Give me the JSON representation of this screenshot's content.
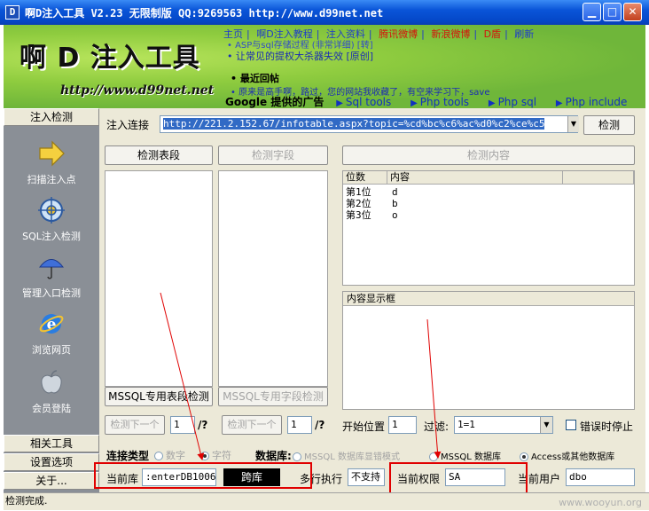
{
  "window": {
    "app_icon": "D",
    "title": "啊D注入工具 V2.23 无限制版 QQ:9269563 http://www.d99net.net"
  },
  "banner": {
    "logo": "啊 D 注入工具",
    "logo_url": "http://www.d99net.net",
    "menu": [
      {
        "label": "主页",
        "color": "#1d3bcc"
      },
      {
        "label": "啊D注入教程",
        "color": "#1d3bcc"
      },
      {
        "label": "注入资料",
        "color": "#1d3bcc"
      },
      {
        "label": "腾讯微博",
        "color": "#d4140c"
      },
      {
        "label": "新浪微博",
        "color": "#d4140c"
      },
      {
        "label": "D盾",
        "color": "#d4140c"
      },
      {
        "label": "刷新",
        "color": "#1d3bcc"
      }
    ],
    "line1": "• ASP与sql存储过程 (非常详细) [转]",
    "line2": "• 让常见的提权大杀器失效 [原创]",
    "hot_title": "最近回帖",
    "hot_line": "• 原来是高手啊，路过，您的网站我收藏了，有空来学习下，save",
    "ads_title": "Google 提供的广告",
    "ads": [
      "Sql tools",
      "Php tools",
      "Php sql",
      "Php include"
    ]
  },
  "sidebar": {
    "top_tab": "注入检测",
    "items": [
      {
        "label": "扫描注入点",
        "icon": "arrow-right-icon"
      },
      {
        "label": "SQL注入检测",
        "icon": "target-icon"
      },
      {
        "label": "管理入口检测",
        "icon": "umbrella-icon"
      },
      {
        "label": "浏览网页",
        "icon": "ie-browser-icon"
      },
      {
        "label": "会员登陆",
        "icon": "apple-icon"
      }
    ],
    "bottom_tabs": [
      "相关工具",
      "设置选项",
      "关于..."
    ]
  },
  "main": {
    "inject_label": "注入连接",
    "url": "http://221.2.152.67/infotable.aspx?topic=%cd%bc%c6%ac%d0%c2%ce%c5",
    "detect_btn": "检测",
    "detect_table_btn": "检测表段",
    "detect_field_btn": "检测字段",
    "detect_content_btn": "检测内容",
    "result_headers": [
      "位数",
      "内容"
    ],
    "result_rows": [
      {
        "pos": "第1位",
        "val": "d"
      },
      {
        "pos": "第2位",
        "val": "b"
      },
      {
        "pos": "第3位",
        "val": "o"
      }
    ],
    "content_box_label": "内容显示框",
    "mssql_table_btn": "MSSQL专用表段检测",
    "mssql_field_btn": "MSSQL专用字段检测",
    "next1_btn": "检测下一个",
    "next1_val": "1",
    "next1_suffix": "/?",
    "next2_btn": "检测下一个",
    "next2_val": "1",
    "next2_suffix": "/?",
    "start_label": "开始位置",
    "start_val": "1",
    "filter_label": "过滤:",
    "filter_val": "1=1",
    "stop_on_error": "错误时停止",
    "conn_type_label": "连接类型",
    "conn_types": [
      "数字",
      "字符"
    ],
    "db_label": "数据库:",
    "db_options": [
      "MSSQL 数据库显错模式",
      "MSSQL 数据库",
      "Access或其他数据库"
    ],
    "current_db_label": "当前库",
    "current_db_val": ":enterDB100609",
    "cross_db_btn": "跨库",
    "multi_exec_label": "多行执行",
    "multi_exec_val": "不支持",
    "perm_label": "当前权限",
    "perm_val": "SA",
    "user_label": "当前用户",
    "user_val": "dbo"
  },
  "status": {
    "text": "检测完成.",
    "watermark": "www.wooyun.org"
  },
  "colors": {
    "titlebar": "#0a55d8",
    "banner": "#6fb63a",
    "sidebar": "#8a8f96",
    "highlight": "#e00000"
  }
}
